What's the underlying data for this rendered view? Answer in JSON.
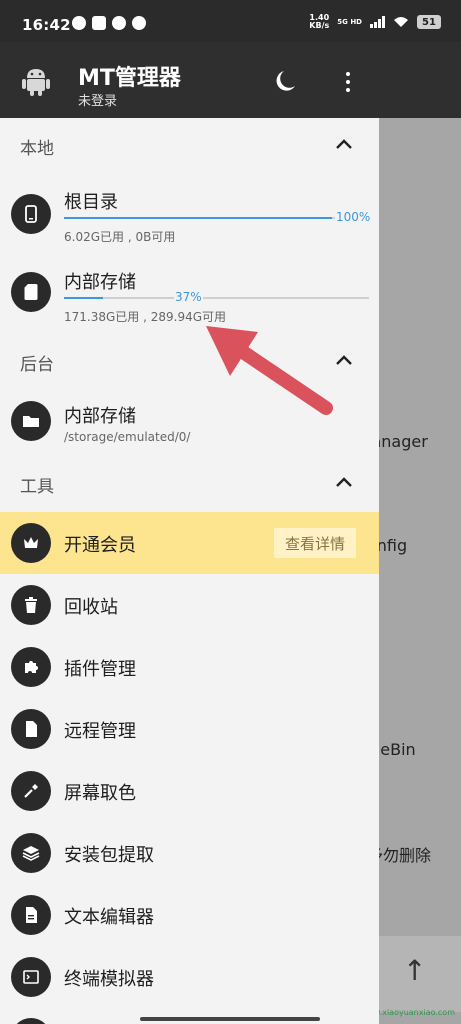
{
  "status_bar": {
    "time": "16:42",
    "speed_value": "1.40",
    "speed_unit": "KB/s",
    "network": "5G HD",
    "battery": "51"
  },
  "header": {
    "title": "MT管理器",
    "subtitle": "未登录",
    "icons": [
      "android-icon",
      "moon-icon",
      "more-vert-icon"
    ]
  },
  "sections": {
    "local": {
      "title": "本地"
    },
    "background": {
      "title": "后台"
    },
    "tools": {
      "title": "工具"
    }
  },
  "local_items": [
    {
      "label": "根目录",
      "usage": "6.02G已用 , 0B可用",
      "percent_label": "100%",
      "percent": 100,
      "icon": "phone-icon"
    },
    {
      "label": "内部存储",
      "usage": "171.38G已用 , 289.94G可用",
      "percent_label": "37%",
      "percent": 37,
      "icon": "sd-card-icon"
    }
  ],
  "background_items": [
    {
      "label": "内部存储",
      "path": "/storage/emulated/0/",
      "icon": "folder-icon"
    }
  ],
  "tool_items": [
    {
      "label": "开通会员",
      "action": "查看详情",
      "icon": "crown-icon",
      "highlight": "#fde48e"
    },
    {
      "label": "回收站",
      "icon": "trash-icon"
    },
    {
      "label": "插件管理",
      "icon": "puzzle-icon"
    },
    {
      "label": "远程管理",
      "icon": "file-icon"
    },
    {
      "label": "屏幕取色",
      "icon": "eyedropper-icon"
    },
    {
      "label": "安装包提取",
      "icon": "layers-icon"
    },
    {
      "label": "文本编辑器",
      "icon": "document-icon"
    },
    {
      "label": "终端模拟器",
      "icon": "terminal-icon"
    }
  ],
  "background_app": {
    "fragments": [
      "e",
      "lanager",
      "onfig",
      "d",
      "cleBin",
      "k",
      "予勿删除"
    ]
  },
  "watermark": "@蓝航小站/www.xiaoyuanxiao.com",
  "colors": {
    "accent": "#3d97de",
    "header": "#2f2f2f",
    "vip": "#fde48e",
    "annotation_arrow": "#d9525c"
  }
}
